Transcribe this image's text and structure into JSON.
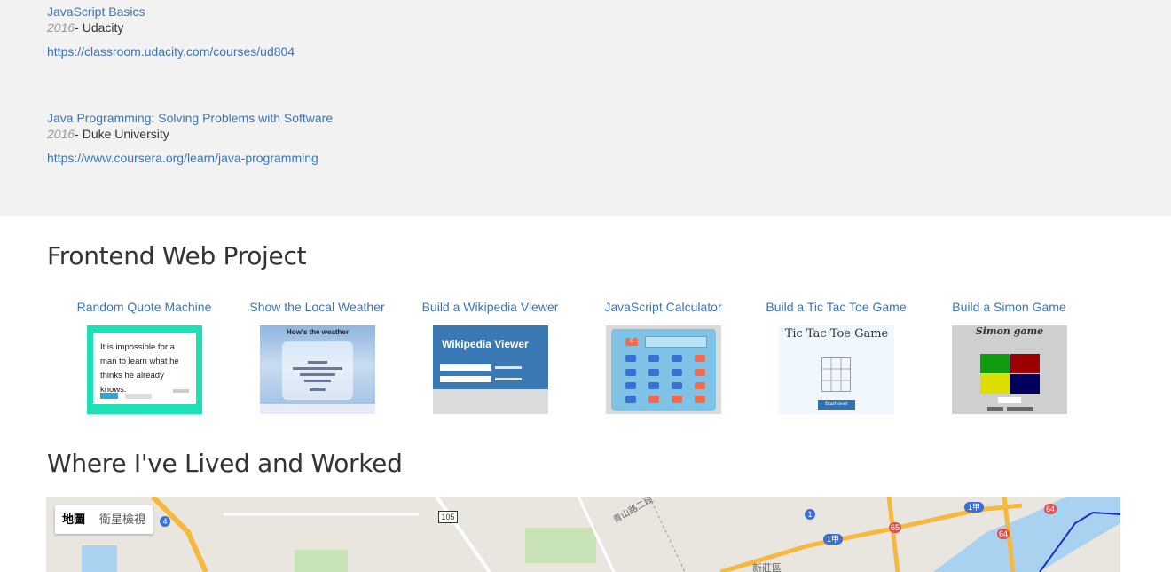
{
  "education": {
    "courses": [
      {
        "title": "JavaScript Basics",
        "year": "2016",
        "school": "- Udacity",
        "url": "https://classroom.udacity.com/courses/ud804"
      },
      {
        "title": "Java Programming: Solving Problems with Software",
        "year": "2016",
        "school": "- Duke University",
        "url": "https://www.coursera.org/learn/java-programming"
      }
    ]
  },
  "projects": {
    "heading": "Frontend Web Project",
    "items": [
      {
        "title": "Random Quote Machine",
        "thumb_text": "It is impossible for a man to learn what he thinks he already knows."
      },
      {
        "title": "Show the Local Weather",
        "thumb_text": "How's the weather"
      },
      {
        "title": "Build a Wikipedia Viewer",
        "thumb_text": "Wikipedia Viewer"
      },
      {
        "title": "JavaScript Calculator",
        "thumb_text": "C"
      },
      {
        "title": "Build a Tic Tac Toe Game",
        "thumb_text": "Tic Tac Toe Game",
        "thumb_button": "Start over"
      },
      {
        "title": "Build a Simon Game",
        "thumb_text": "Simon game"
      }
    ]
  },
  "lived": {
    "heading": "Where I've Lived and Worked",
    "map": {
      "map_type_options": [
        "地圖",
        "衛星檢視"
      ],
      "selected": "地圖",
      "labels": {
        "road_105": "105",
        "route_4": "4",
        "route_1": "1",
        "route_1jia_a": "1甲",
        "route_1jia_b": "1甲",
        "route_65": "65",
        "route_64_a": "64",
        "route_64_b": "64",
        "xinzhuang": "新莊區",
        "qingshan": "青山路二段"
      },
      "colors": {
        "highway": "#f6b940",
        "water": "#a9d2f0",
        "park": "#c8e3b5",
        "metro": "#1a2fc9"
      }
    }
  }
}
